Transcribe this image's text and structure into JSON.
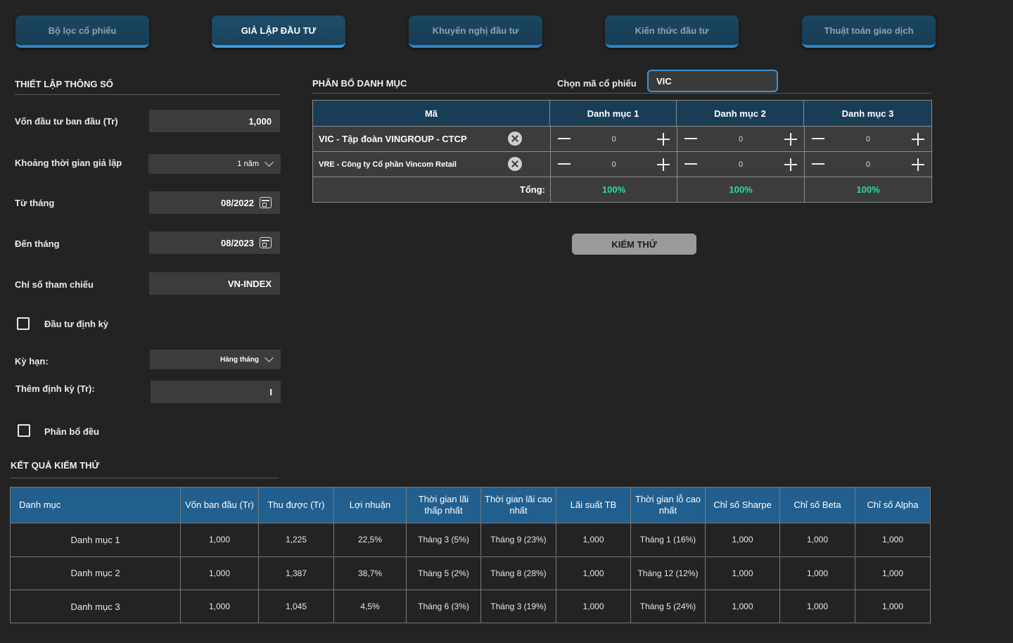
{
  "nav": {
    "tabs": [
      {
        "label": "Bộ lọc cổ phiếu"
      },
      {
        "label": "GIẢ LẬP ĐẦU TƯ"
      },
      {
        "label": "Khuyến nghị đầu tư"
      },
      {
        "label": "Kiến thức đầu tư"
      },
      {
        "label": "Thuật toán giao dịch"
      }
    ],
    "active_index": 1
  },
  "settings": {
    "title": "THIẾT LẬP THÔNG SỐ",
    "initial_capital_label": "Vốn đầu tư ban đầu (Tr)",
    "initial_capital_value": "1,000",
    "period_label": "Khoảng thời gian giả lập",
    "period_value": "1 năm",
    "from_label": "Từ tháng",
    "from_value": "08/2022",
    "to_label": "Đến tháng",
    "to_value": "08/2023",
    "benchmark_label": "Chỉ số tham chiếu",
    "benchmark_value": "VN-INDEX",
    "periodic_label": "Đầu tư định kỳ",
    "term_label": "Kỳ hạn:",
    "term_value": "Hàng tháng",
    "periodic_add_label": "Thêm định kỳ (Tr):",
    "periodic_add_value": "I",
    "equal_label": "Phân bổ đều"
  },
  "allocation": {
    "title": "PHÂN BỔ DANH MỤC",
    "symbol_label": "Chọn mã cổ phiếu",
    "symbol_value": "VIC",
    "headers": [
      "Mã",
      "Danh mục 1",
      "Danh mục 2",
      "Danh mục 3"
    ],
    "rows": [
      {
        "name": "VIC - Tập đoàn VINGROUP - CTCP",
        "values": [
          "0",
          "0",
          "0"
        ]
      },
      {
        "name": "VRE - Công ty Cổ phần Vincom Retail",
        "values": [
          "0",
          "0",
          "0"
        ]
      }
    ],
    "total_label": "Tổng:",
    "totals": [
      "100%",
      "100%",
      "100%"
    ],
    "total_color": "#22e0a0",
    "test_button": "KIỂM THỬ"
  },
  "results": {
    "title": "KẾT QUẢ KIỂM THỬ",
    "headers": [
      "Danh mục",
      "Vốn ban đầu (Tr)",
      "Thu được (Tr)",
      "Lợi nhuận",
      "Thời gian lãi thấp nhất",
      "Thời gian lãi cao nhất",
      "Lãi suất TB",
      "Thời gian lỗ cao nhất",
      "Chỉ số Sharpe",
      "Chỉ số Beta",
      "Chỉ số Alpha"
    ],
    "rows": [
      [
        "Danh mục  1",
        "1,000",
        "1,225",
        "22,5%",
        "Tháng 3 (5%)",
        "Tháng 9 (23%)",
        "1,000",
        "Tháng 1 (16%)",
        "1,000",
        "1,000",
        "1,000"
      ],
      [
        "Danh mục 2",
        "1,000",
        "1,387",
        "38,7%",
        "Tháng 5 (2%)",
        "Tháng 8 (28%)",
        "1,000",
        "Tháng 12 (12%)",
        "1,000",
        "1,000",
        "1,000"
      ],
      [
        "Danh mục 3",
        "1,000",
        "1,045",
        "4,5%",
        "Tháng 6 (3%)",
        "Tháng 3 (19%)",
        "1,000",
        "Tháng 5 (24%)",
        "1,000",
        "1,000",
        "1,000"
      ]
    ]
  }
}
